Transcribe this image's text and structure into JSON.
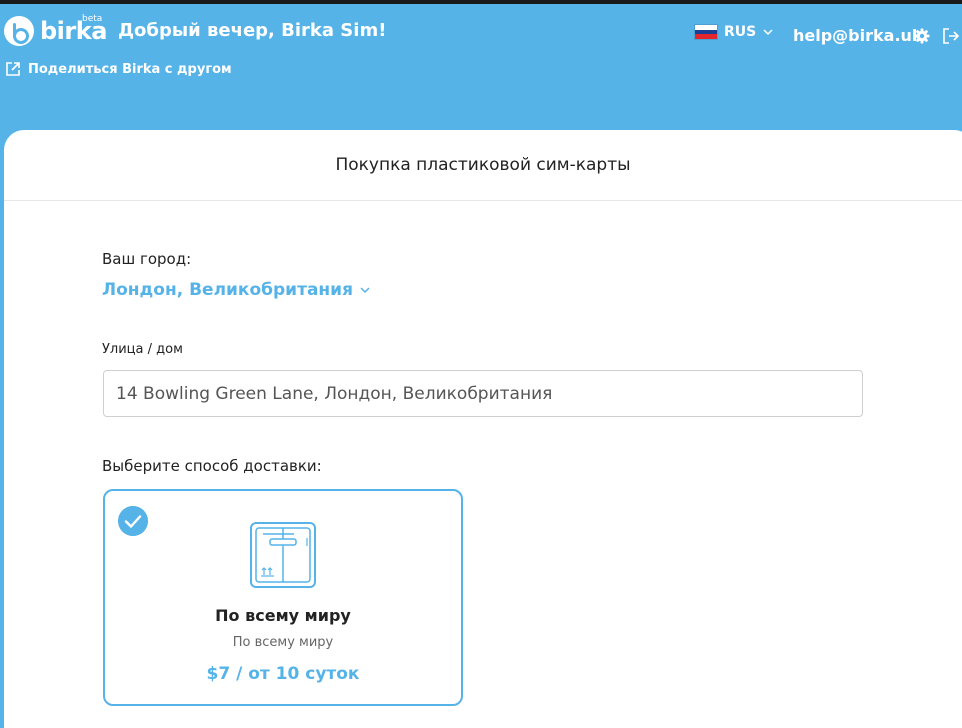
{
  "header": {
    "logo_text": "birka",
    "logo_badge": "beta",
    "greeting": "Добрый вечер, Birka Sim!",
    "share_label": "Поделиться Birka с другом",
    "language": "RUS",
    "support_email": "help@birka.uk"
  },
  "card": {
    "title": "Покупка пластиковой сим-карты"
  },
  "form": {
    "city_label": "Ваш город:",
    "city_value": "Лондон, Великобритания",
    "street_label": "Улица / дом",
    "street_value": "14 Bowling Green Lane, Лондон, Великобритания",
    "delivery_label": "Выберите способ доставки:"
  },
  "delivery_options": [
    {
      "title": "По всему миру",
      "subtitle": "По всему миру",
      "price": "$7 / от 10 суток",
      "selected": true,
      "icon": "parcel-box-icon"
    }
  ],
  "colors": {
    "brand": "#55b3e8",
    "text": "#222222"
  }
}
